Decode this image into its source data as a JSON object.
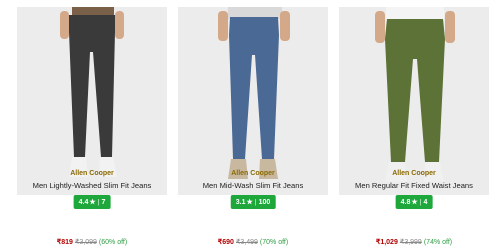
{
  "products": [
    {
      "brand": "Allen Cooper",
      "title": "Men Lightly-Washed Slim Fit Jeans",
      "rating": "4.4",
      "reviews": "7",
      "price": "₹819",
      "mrp": "₹3,099",
      "discount": "(60% off)",
      "jeans_color": "#3a3a3a",
      "shoe_color": "#f2f2f2",
      "shirt_color": "#7a6048"
    },
    {
      "brand": "Allen Cooper",
      "title": "Men Mid-Wash Slim Fit Jeans",
      "rating": "3.1",
      "reviews": "100",
      "price": "₹690",
      "mrp": "₹3,499",
      "discount": "(70% off)",
      "jeans_color": "#4a6a95",
      "shoe_color": "#c9b8a0",
      "shirt_color": "#d9d9d9"
    },
    {
      "brand": "Allen Cooper",
      "title": "Men Regular Fit Fixed Waist Jeans",
      "rating": "4.8",
      "reviews": "4",
      "price": "₹1,029",
      "mrp": "₹3,999",
      "discount": "(74% off)",
      "jeans_color": "#5c7236",
      "shoe_color": "#f0f0f0",
      "shirt_color": "#f4f4f4"
    }
  ],
  "icons": {
    "rating_star": "★"
  }
}
